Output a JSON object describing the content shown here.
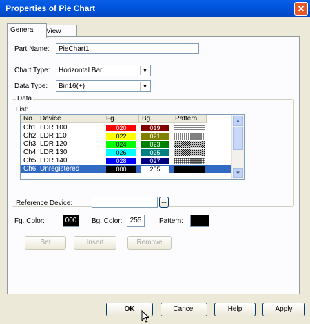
{
  "window": {
    "title": "Properties of Pie Chart",
    "close_glyph": "✕"
  },
  "tabs": [
    {
      "label": "General"
    },
    {
      "label": "View"
    }
  ],
  "form": {
    "part_name_label": "Part Name:",
    "part_name_value": "PieChart1",
    "chart_type_label": "Chart Type:",
    "chart_type_value": "Horizontal Bar",
    "data_type_label": "Data Type:",
    "data_type_value": "Bin16(+)"
  },
  "data_group": {
    "title": "Data",
    "list_label": "List:",
    "columns": [
      "No.",
      "Device",
      "Fg.",
      "Bg.",
      "Pattern"
    ],
    "rows": [
      {
        "no": "Ch1",
        "device": "LDR 100",
        "fg": "020",
        "fg_color": "#ff0000",
        "bg": "019",
        "bg_color": "#800000",
        "pattern": "hlines"
      },
      {
        "no": "Ch2",
        "device": "LDR 110",
        "fg": "022",
        "fg_color": "#ffff00",
        "bg": "021",
        "bg_color": "#808000",
        "pattern": "vlines"
      },
      {
        "no": "Ch3",
        "device": "LDR 120",
        "fg": "024",
        "fg_color": "#00ff00",
        "bg": "023",
        "bg_color": "#008000",
        "pattern": "diag"
      },
      {
        "no": "Ch4",
        "device": "LDR 130",
        "fg": "026",
        "fg_color": "#00ffff",
        "bg": "025",
        "bg_color": "#008080",
        "pattern": "diag2"
      },
      {
        "no": "Ch5",
        "device": "LDR 140",
        "fg": "028",
        "fg_color": "#0000ff",
        "bg": "027",
        "bg_color": "#000080",
        "pattern": "grid"
      },
      {
        "no": "Ch6",
        "device": "Unregistered",
        "fg": "000",
        "fg_color": "#000000",
        "bg": "255",
        "bg_color": "#ffffff",
        "pattern": "solid"
      }
    ],
    "selected_row": 5
  },
  "reference": {
    "label": "Reference Device:",
    "value": "",
    "browse_label": "..."
  },
  "colors": {
    "fg_label": "Fg. Color:",
    "fg_value": "000",
    "bg_label": "Bg. Color:",
    "bg_value": "255",
    "pattern_label": "Pattern:"
  },
  "actions": {
    "set": "Set",
    "insert": "Insert",
    "remove": "Remove"
  },
  "footer": {
    "ok": "OK",
    "cancel": "Cancel",
    "help": "Help",
    "apply": "Apply"
  }
}
